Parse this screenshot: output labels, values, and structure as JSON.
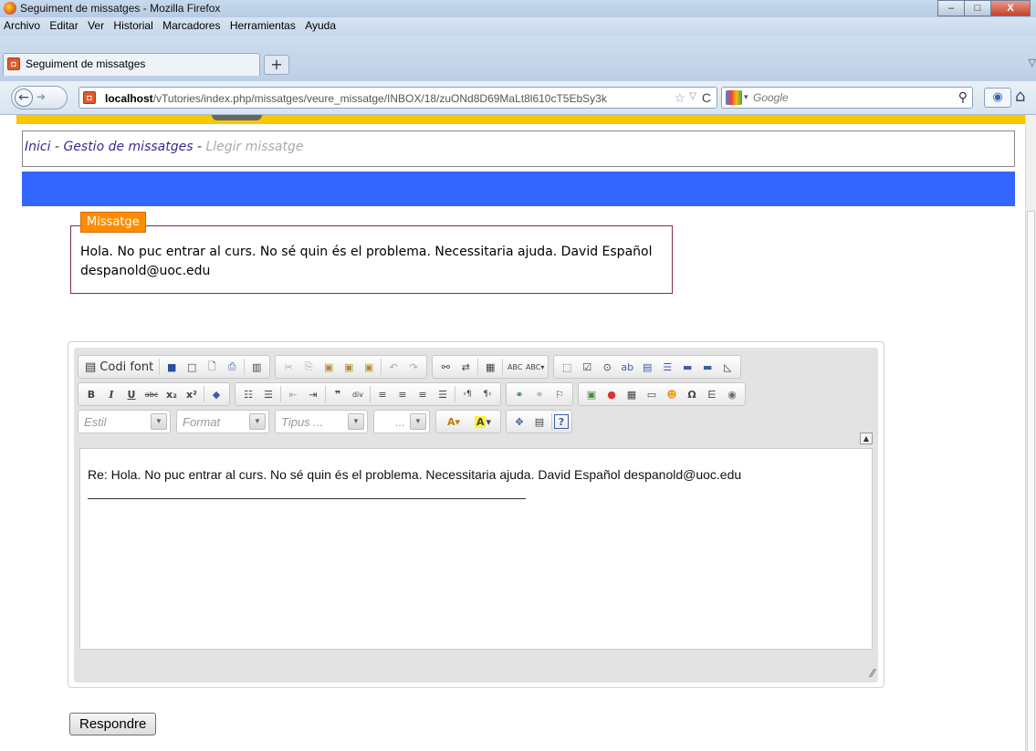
{
  "window": {
    "title": "Seguiment de missatges - Mozilla Firefox",
    "min": "–",
    "max": "□",
    "close": "X"
  },
  "menu": [
    "Archivo",
    "Editar",
    "Ver",
    "Historial",
    "Marcadores",
    "Herramientas",
    "Ayuda"
  ],
  "tab": {
    "label": "Seguiment de missatges",
    "new_tab": "+"
  },
  "nav": {
    "url_host": "localhost",
    "url_path": "/vTutories/index.php/missatges/veure_missatge/INBOX/18/zuONd8D69MaLt8l610cT5EbSy3k",
    "search_placeholder": "Google"
  },
  "breadcrumb": {
    "home": "Inici",
    "sep": " - ",
    "manage": "Gestio de missatges",
    "current": "Llegir missatge"
  },
  "message": {
    "legend": "Missatge",
    "body": "Hola. No puc entrar al curs. No sé quin és el problema. Necessitaria ajuda. David Español despanold@uoc.edu"
  },
  "editor": {
    "source_label": "Codi font",
    "combo_style": "Estil",
    "combo_format": "Format",
    "combo_font": "Tipus ...",
    "combo_size": "...",
    "content": "Re: Hola. No puc entrar al curs. No sé quin és el problema. Necessitaria ajuda. David Español despanold@uoc.edu"
  },
  "reply_button": "Respondre",
  "colors": {
    "yellow_bar": "#f7c800",
    "blue_bar": "#3366ff",
    "legend_bg": "#ff8c00",
    "breadcrumb_link": "#3b2a8c"
  }
}
